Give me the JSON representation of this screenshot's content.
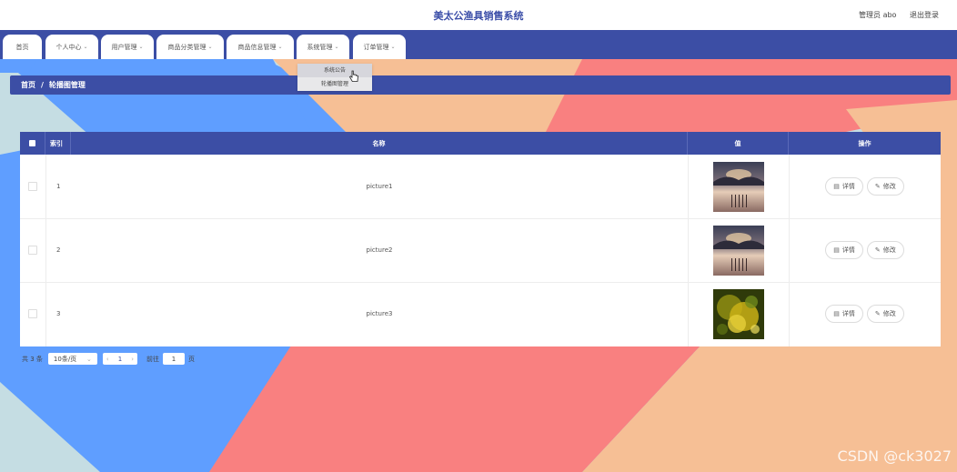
{
  "header": {
    "title": "美太公渔具销售系统",
    "user_label": "管理员 abo",
    "logout_label": "退出登录"
  },
  "nav": {
    "items": [
      {
        "label": "首页",
        "dropdown": false
      },
      {
        "label": "个人中心",
        "dropdown": true
      },
      {
        "label": "用户管理",
        "dropdown": true
      },
      {
        "label": "商品分类管理",
        "dropdown": true
      },
      {
        "label": "商品信息管理",
        "dropdown": true
      },
      {
        "label": "系统管理",
        "dropdown": true
      },
      {
        "label": "订单管理",
        "dropdown": true
      }
    ],
    "dropdown_items": [
      "系统公告",
      "轮播图管理"
    ],
    "chevron_icon": "chevron-down-icon"
  },
  "breadcrumb": {
    "home": "首页",
    "separator": "/",
    "current": "轮播图管理"
  },
  "table": {
    "columns": [
      "索引",
      "名称",
      "值",
      "操作"
    ],
    "rows": [
      {
        "index": "1",
        "name": "picture1",
        "image": "dusk-lake-pier"
      },
      {
        "index": "2",
        "name": "picture2",
        "image": "dusk-lake-pier"
      },
      {
        "index": "3",
        "name": "picture3",
        "image": "yellow-green-bokeh"
      }
    ],
    "detail_label": "详情",
    "edit_label": "修改",
    "detail_icon": "document-icon",
    "edit_icon": "pencil-icon"
  },
  "pagination": {
    "total": "共 3 条",
    "page_size": "10条/页",
    "prev_icon": "chevron-left-icon",
    "current_page": "1",
    "next_icon": "chevron-right-icon",
    "goto_label": "前往",
    "goto_value": "1",
    "page_suffix": "页"
  },
  "colors": {
    "primary": "#3c4ea5",
    "bg_blue": "#5f9eff",
    "bg_peach": "#f6bf95",
    "bg_coral": "#f98080",
    "bg_teal": "#c5dde3"
  },
  "watermark": "CSDN @ck3027"
}
